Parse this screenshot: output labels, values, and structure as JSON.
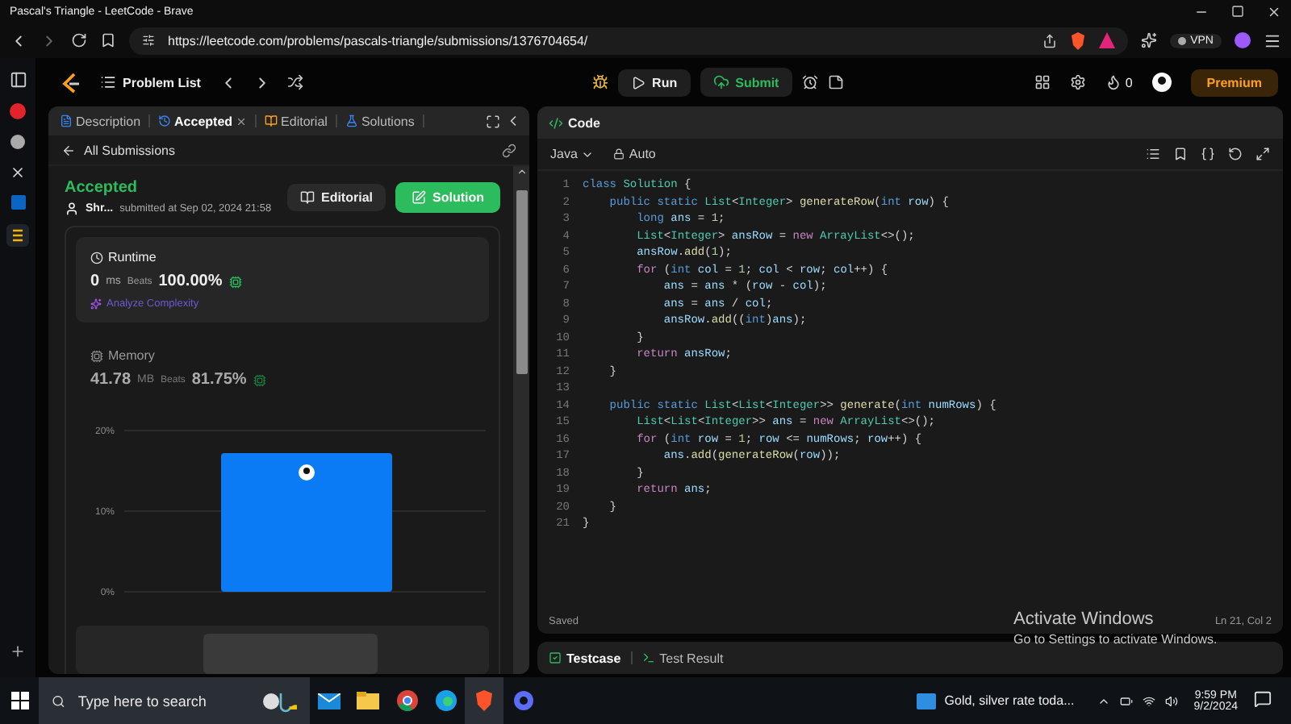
{
  "window": {
    "title": "Pascal's Triangle - LeetCode - Brave"
  },
  "address_bar": {
    "url": "https://leetcode.com/problems/pascals-triangle/submissions/1376704654/",
    "vpn_label": "VPN"
  },
  "topbar": {
    "problem_list": "Problem List",
    "run": "Run",
    "submit": "Submit",
    "streak": "0",
    "premium": "Premium"
  },
  "tabs": [
    {
      "label": "Description",
      "selected": false,
      "closable": false
    },
    {
      "label": "Accepted",
      "selected": true,
      "closable": true
    },
    {
      "label": "Editorial",
      "selected": false,
      "closable": false
    },
    {
      "label": "Solutions",
      "selected": false,
      "closable": false
    }
  ],
  "back_link": "All Submissions",
  "submission": {
    "status": "Accepted",
    "user": "Shr...",
    "submitted": "submitted at Sep 02, 2024 21:58",
    "editorial_button": "Editorial",
    "solution_button": "Solution"
  },
  "runtime": {
    "title": "Runtime",
    "value": "0",
    "unit": "ms",
    "beats_label": "Beats",
    "beats": "100.00%",
    "analyze": "Analyze Complexity"
  },
  "memory": {
    "title": "Memory",
    "value": "41.78",
    "unit": "MB",
    "beats_label": "Beats",
    "beats": "81.75%"
  },
  "chart_data": {
    "type": "bar",
    "categories": [
      null
    ],
    "values": [
      17.2
    ],
    "ylim": [
      0,
      20
    ],
    "yticks": [
      {
        "value": 0,
        "label": "0%"
      },
      {
        "value": 10,
        "label": "10%"
      },
      {
        "value": 20,
        "label": "20%"
      }
    ]
  },
  "editor": {
    "title": "Code",
    "language": "Java",
    "mode": "Auto",
    "status": "Saved",
    "cursor": "Ln 21, Col 2",
    "lines": [
      {
        "number": "1",
        "tokens": [
          {
            "text": "class",
            "kind": "kw"
          },
          {
            "text": " Solution",
            "kind": "type"
          },
          {
            "text": " {",
            "kind": "plain"
          }
        ]
      },
      {
        "number": "2",
        "tokens": [
          {
            "text": "    public static",
            "kind": "kw"
          },
          {
            "text": " List",
            "kind": "type"
          },
          {
            "text": "<",
            "kind": "plain"
          },
          {
            "text": "Integer",
            "kind": "type"
          },
          {
            "text": ">",
            "kind": "plain"
          },
          {
            "text": " generateRow",
            "kind": "fn"
          },
          {
            "text": "(",
            "kind": "plain"
          },
          {
            "text": "int",
            "kind": "kw"
          },
          {
            "text": " row",
            "kind": "var"
          },
          {
            "text": ") {",
            "kind": "plain"
          }
        ]
      },
      {
        "number": "3",
        "tokens": [
          {
            "text": "        long",
            "kind": "kw"
          },
          {
            "text": " ans",
            "kind": "var"
          },
          {
            "text": " = ",
            "kind": "plain"
          },
          {
            "text": "1",
            "kind": "num"
          },
          {
            "text": ";",
            "kind": "plain"
          }
        ]
      },
      {
        "number": "4",
        "tokens": [
          {
            "text": "        List",
            "kind": "type"
          },
          {
            "text": "<",
            "kind": "plain"
          },
          {
            "text": "Integer",
            "kind": "type"
          },
          {
            "text": ">",
            "kind": "plain"
          },
          {
            "text": " ansRow",
            "kind": "var"
          },
          {
            "text": " = ",
            "kind": "plain"
          },
          {
            "text": "new",
            "kind": "ctrl"
          },
          {
            "text": " ArrayList",
            "kind": "type"
          },
          {
            "text": "<>();",
            "kind": "plain"
          }
        ]
      },
      {
        "number": "5",
        "tokens": [
          {
            "text": "        ansRow",
            "kind": "var"
          },
          {
            "text": ".",
            "kind": "plain"
          },
          {
            "text": "add",
            "kind": "fn"
          },
          {
            "text": "(",
            "kind": "plain"
          },
          {
            "text": "1",
            "kind": "num"
          },
          {
            "text": ");",
            "kind": "plain"
          }
        ]
      },
      {
        "number": "6",
        "tokens": [
          {
            "text": "        for",
            "kind": "ctrl"
          },
          {
            "text": " (",
            "kind": "plain"
          },
          {
            "text": "int",
            "kind": "kw"
          },
          {
            "text": " col",
            "kind": "var"
          },
          {
            "text": " = ",
            "kind": "plain"
          },
          {
            "text": "1",
            "kind": "num"
          },
          {
            "text": "; ",
            "kind": "plain"
          },
          {
            "text": "col",
            "kind": "var"
          },
          {
            "text": " < ",
            "kind": "plain"
          },
          {
            "text": "row",
            "kind": "var"
          },
          {
            "text": "; ",
            "kind": "plain"
          },
          {
            "text": "col",
            "kind": "var"
          },
          {
            "text": "++) {",
            "kind": "plain"
          }
        ]
      },
      {
        "number": "7",
        "tokens": [
          {
            "text": "            ans",
            "kind": "var"
          },
          {
            "text": " = ",
            "kind": "plain"
          },
          {
            "text": "ans",
            "kind": "var"
          },
          {
            "text": " * (",
            "kind": "plain"
          },
          {
            "text": "row",
            "kind": "var"
          },
          {
            "text": " - ",
            "kind": "plain"
          },
          {
            "text": "col",
            "kind": "var"
          },
          {
            "text": ");",
            "kind": "plain"
          }
        ]
      },
      {
        "number": "8",
        "tokens": [
          {
            "text": "            ans",
            "kind": "var"
          },
          {
            "text": " = ",
            "kind": "plain"
          },
          {
            "text": "ans",
            "kind": "var"
          },
          {
            "text": " / ",
            "kind": "plain"
          },
          {
            "text": "col",
            "kind": "var"
          },
          {
            "text": ";",
            "kind": "plain"
          }
        ]
      },
      {
        "number": "9",
        "tokens": [
          {
            "text": "            ansRow",
            "kind": "var"
          },
          {
            "text": ".",
            "kind": "plain"
          },
          {
            "text": "add",
            "kind": "fn"
          },
          {
            "text": "((",
            "kind": "plain"
          },
          {
            "text": "int",
            "kind": "kw"
          },
          {
            "text": ")",
            "kind": "plain"
          },
          {
            "text": "ans",
            "kind": "var"
          },
          {
            "text": ");",
            "kind": "plain"
          }
        ]
      },
      {
        "number": "10",
        "tokens": [
          {
            "text": "        }",
            "kind": "plain"
          }
        ]
      },
      {
        "number": "11",
        "tokens": [
          {
            "text": "        return",
            "kind": "ctrl"
          },
          {
            "text": " ansRow",
            "kind": "var"
          },
          {
            "text": ";",
            "kind": "plain"
          }
        ]
      },
      {
        "number": "12",
        "tokens": [
          {
            "text": "    }",
            "kind": "plain"
          }
        ]
      },
      {
        "number": "13"
      },
      {
        "number": "14",
        "tokens": [
          {
            "text": "    public static",
            "kind": "kw"
          },
          {
            "text": " List",
            "kind": "type"
          },
          {
            "text": "<",
            "kind": "plain"
          },
          {
            "text": "List",
            "kind": "type"
          },
          {
            "text": "<",
            "kind": "plain"
          },
          {
            "text": "Integer",
            "kind": "type"
          },
          {
            "text": ">>",
            "kind": "plain"
          },
          {
            "text": " generate",
            "kind": "fn"
          },
          {
            "text": "(",
            "kind": "plain"
          },
          {
            "text": "int",
            "kind": "kw"
          },
          {
            "text": " numRows",
            "kind": "var"
          },
          {
            "text": ") {",
            "kind": "plain"
          }
        ]
      },
      {
        "number": "15",
        "tokens": [
          {
            "text": "        List",
            "kind": "type"
          },
          {
            "text": "<",
            "kind": "plain"
          },
          {
            "text": "List",
            "kind": "type"
          },
          {
            "text": "<",
            "kind": "plain"
          },
          {
            "text": "Integer",
            "kind": "type"
          },
          {
            "text": ">>",
            "kind": "plain"
          },
          {
            "text": " ans",
            "kind": "var"
          },
          {
            "text": " = ",
            "kind": "plain"
          },
          {
            "text": "new",
            "kind": "ctrl"
          },
          {
            "text": " ArrayList",
            "kind": "type"
          },
          {
            "text": "<>();",
            "kind": "plain"
          }
        ]
      },
      {
        "number": "16",
        "tokens": [
          {
            "text": "        for",
            "kind": "ctrl"
          },
          {
            "text": " (",
            "kind": "plain"
          },
          {
            "text": "int",
            "kind": "kw"
          },
          {
            "text": " row",
            "kind": "var"
          },
          {
            "text": " = ",
            "kind": "plain"
          },
          {
            "text": "1",
            "kind": "num"
          },
          {
            "text": "; ",
            "kind": "plain"
          },
          {
            "text": "row",
            "kind": "var"
          },
          {
            "text": " <= ",
            "kind": "plain"
          },
          {
            "text": "numRows",
            "kind": "var"
          },
          {
            "text": "; ",
            "kind": "plain"
          },
          {
            "text": "row",
            "kind": "var"
          },
          {
            "text": "++) {",
            "kind": "plain"
          }
        ]
      },
      {
        "number": "17",
        "tokens": [
          {
            "text": "            ans",
            "kind": "var"
          },
          {
            "text": ".",
            "kind": "plain"
          },
          {
            "text": "add",
            "kind": "fn"
          },
          {
            "text": "(",
            "kind": "plain"
          },
          {
            "text": "generateRow",
            "kind": "fn"
          },
          {
            "text": "(",
            "kind": "plain"
          },
          {
            "text": "row",
            "kind": "var"
          },
          {
            "text": "));",
            "kind": "plain"
          }
        ]
      },
      {
        "number": "18",
        "tokens": [
          {
            "text": "        }",
            "kind": "plain"
          }
        ]
      },
      {
        "number": "19",
        "tokens": [
          {
            "text": "        return",
            "kind": "ctrl"
          },
          {
            "text": " ans",
            "kind": "var"
          },
          {
            "text": ";",
            "kind": "plain"
          }
        ]
      },
      {
        "number": "20",
        "tokens": [
          {
            "text": "    }",
            "kind": "plain"
          }
        ]
      },
      {
        "number": "21",
        "tokens": [
          {
            "text": "}",
            "kind": "plain"
          }
        ]
      }
    ]
  },
  "bottom_tabs": [
    {
      "label": "Testcase",
      "selected": true
    },
    {
      "label": "Test Result",
      "selected": false
    }
  ],
  "activation": {
    "title": "Activate Windows",
    "subtitle": "Go to Settings to activate Windows."
  },
  "taskbar": {
    "search_placeholder": "Type here to search",
    "news": "Gold, silver rate toda...",
    "time": "9:59 PM",
    "date": "9/2/2024"
  }
}
